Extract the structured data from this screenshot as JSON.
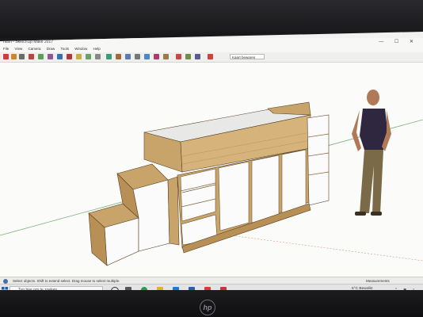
{
  "window": {
    "title": "ndsn - SketchUp Make 2017",
    "controls": "— ☐ ✕"
  },
  "menu": [
    "File",
    "View",
    "Camera",
    "Draw",
    "Tools",
    "Window",
    "Help"
  ],
  "toolbar": {
    "dropdown_value": "Kaart bewaren"
  },
  "status_bar": {
    "hint": "Select objects. Shift to extend select. Drag mouse to select multiple.",
    "measurements_label": "Measurements"
  },
  "taskbar": {
    "search_placeholder": "Typ hier om te zoeken",
    "weather": "6°C  Bewolkt"
  },
  "monitor": {
    "brand": "hp"
  },
  "colors": {
    "wood": "#c9a46a",
    "white_panel": "#fbfbfb",
    "figure_shirt": "#2f2740",
    "figure_pants": "#7a6a48"
  }
}
